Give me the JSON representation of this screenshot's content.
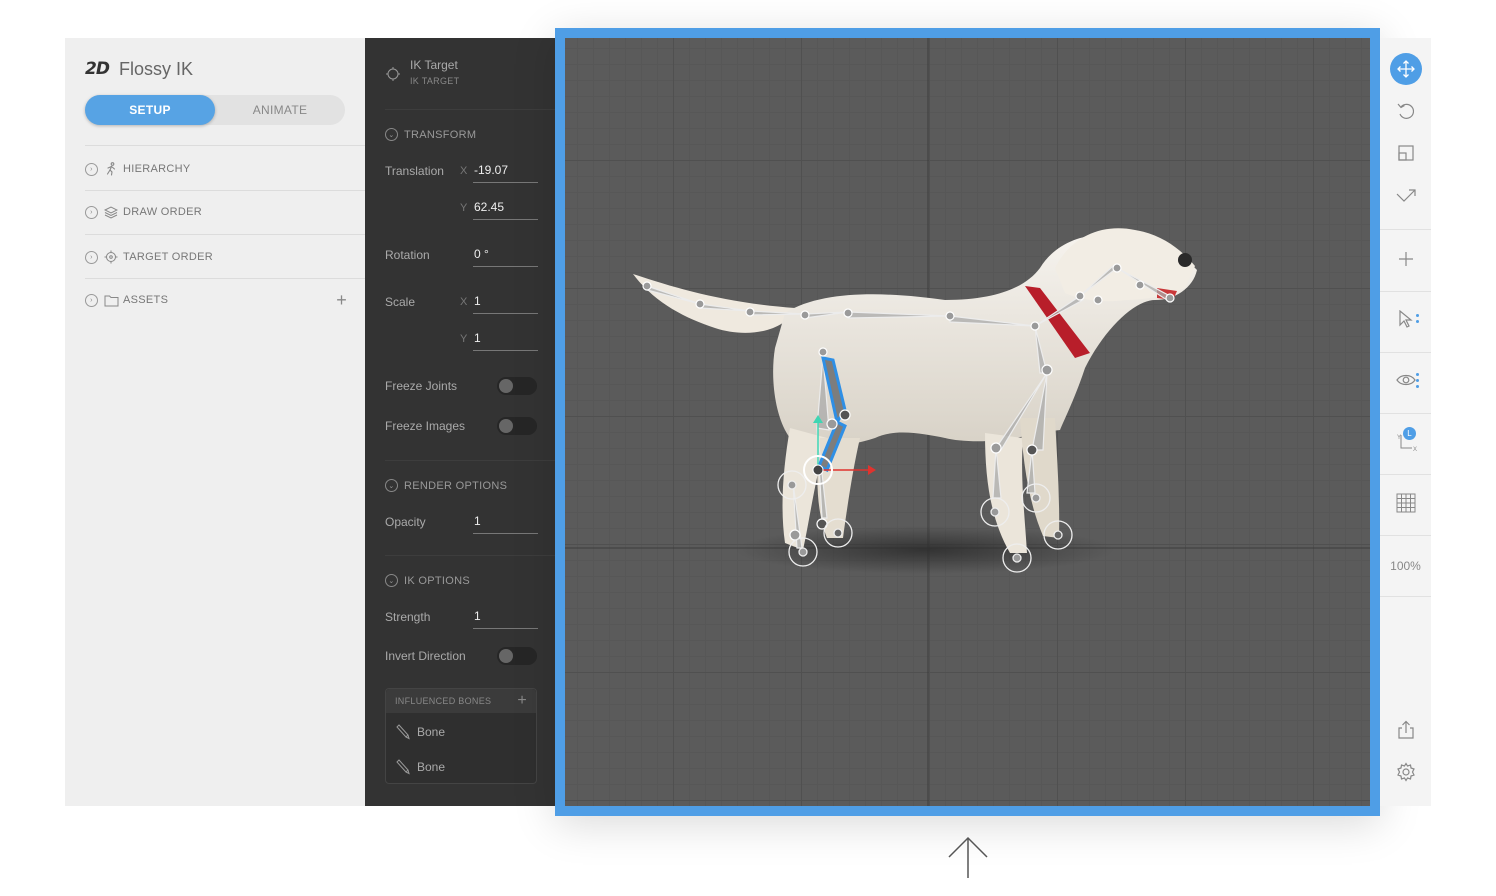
{
  "app": {
    "logo": "2D",
    "file_name": "Flossy IK",
    "modes": {
      "setup": "SETUP",
      "animate": "ANIMATE"
    }
  },
  "hierarchy_panel": {
    "items": [
      {
        "label": "HIERARCHY",
        "icon": "running-figure-icon"
      },
      {
        "label": "DRAW ORDER",
        "icon": "layers-icon"
      },
      {
        "label": "TARGET ORDER",
        "icon": "target-icon"
      },
      {
        "label": "ASSETS",
        "icon": "folder-icon"
      }
    ]
  },
  "properties": {
    "object_name": "IK Target",
    "object_type": "IK TARGET",
    "transform_section": "TRANSFORM",
    "translation_label": "Translation",
    "x_axis": "X",
    "y_axis": "Y",
    "translation_x": "-19.07",
    "translation_y": "62.45",
    "rotation_label": "Rotation",
    "rotation": "0 °",
    "scale_label": "Scale",
    "scale_x": "1",
    "scale_y": "1",
    "freeze_joints_label": "Freeze Joints",
    "freeze_joints": false,
    "freeze_images_label": "Freeze Images",
    "freeze_images": false,
    "render_section": "RENDER OPTIONS",
    "opacity_label": "Opacity",
    "opacity": "1",
    "ik_section": "IK OPTIONS",
    "strength_label": "Strength",
    "strength": "1",
    "invert_label": "Invert Direction",
    "invert_direction": false,
    "influenced_bones_label": "INFLUENCED BONES",
    "bones": [
      "Bone",
      "Bone"
    ]
  },
  "toolbar": {
    "tools": [
      "move-icon",
      "rotate-icon",
      "scale-icon",
      "transform-icon",
      "add-icon",
      "select-icon",
      "visibility-icon",
      "axis-icon",
      "grid-icon",
      "export-icon",
      "settings-icon"
    ],
    "active_tool": "move-icon",
    "axis_badge": "L",
    "zoom": "100%"
  },
  "colors": {
    "accent": "#4f9ee6",
    "panel_light": "#efefef",
    "panel_dark": "#333333",
    "stage": "#5b5b5b"
  }
}
